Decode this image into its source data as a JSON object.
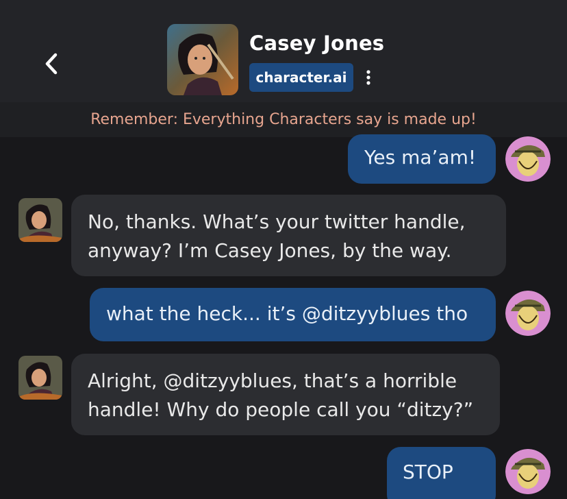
{
  "header": {
    "character_name": "Casey Jones",
    "badge_text": "character.ai"
  },
  "notice": "Remember: Everything Characters say is made up!",
  "messages": [
    {
      "sender": "user",
      "text": "Yes ma’am!"
    },
    {
      "sender": "character",
      "lines": [
        "No, thanks. What’s your twitter handle,",
        "anyway? I’m Casey Jones, by the way."
      ]
    },
    {
      "sender": "user",
      "text": "what the heck... it’s @ditzyyblues tho"
    },
    {
      "sender": "character",
      "lines": [
        "Alright, @ditzyyblues, that’s a horrible",
        "handle! Why do people call you “ditzy?”"
      ]
    },
    {
      "sender": "user",
      "text": "STOP"
    }
  ],
  "colors": {
    "background": "#18181b",
    "header": "#232428",
    "user_bubble": "#1d4a80",
    "character_bubble": "#2c2d31",
    "notice_text": "#e7a58f"
  },
  "icons": [
    "back-arrow-icon",
    "more-vertical-icon"
  ]
}
